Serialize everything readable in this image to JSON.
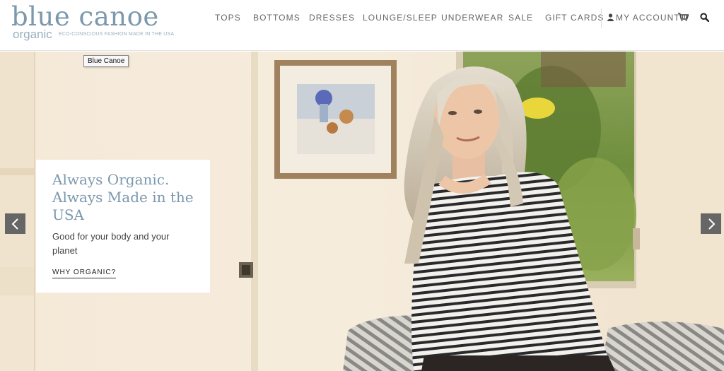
{
  "brand": {
    "name": "blue canoe",
    "sub": "organic",
    "tagline": "ECO-CONSCIOUS FASHION MADE IN THE USA",
    "color": "#7b98ad"
  },
  "tooltip": "Blue Canoe",
  "nav": {
    "items": [
      "TOPS",
      "BOTTOMS",
      "DRESSES",
      "LOUNGE/SLEEP",
      "UNDERWEAR",
      "SALE",
      "GIFT CARDS"
    ],
    "account": "MY ACCOUNT",
    "icons": [
      "user-icon",
      "cart-icon",
      "search-icon"
    ]
  },
  "hero": {
    "title": "Always Organic. Always Made in the USA",
    "subtitle": "Good for your body and your planet",
    "cta": "WHY ORGANIC?"
  },
  "carousel": {
    "prev_icon": "chevron-left-icon",
    "next_icon": "chevron-right-icon"
  }
}
